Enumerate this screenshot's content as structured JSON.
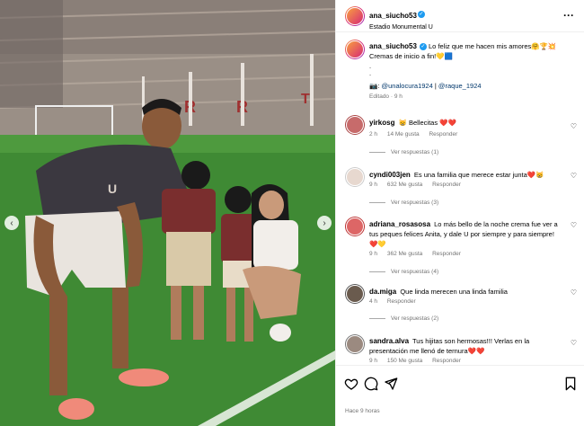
{
  "post": {
    "username": "ana_siucho53",
    "location": "Estadio Monumental U",
    "caption_text": "Lo feliz que me hacen mis amores🤗🏆💥 Cremas de inicio a fin!💛🟦",
    "caption_dots": [
      "."
    ],
    "mentions": [
      "@unalocura1924",
      "@raque_1924"
    ],
    "edited": "Editado · 9 h",
    "time_ago": "Hace 9 horas"
  },
  "comments": [
    {
      "username": "yirkosg",
      "text": "😸 Bellecitas ❤️❤️",
      "time": "2 h",
      "likes": "14 Me gusta",
      "reply": "Responder",
      "view_replies": "Ver respuestas (1)"
    },
    {
      "username": "cyndi003jen",
      "text": "Es una familia que merece estar junta❤️😸",
      "time": "9 h",
      "likes": "632 Me gusta",
      "reply": "Responder",
      "view_replies": "Ver respuestas (3)"
    },
    {
      "username": "adriana_rosasosa",
      "text": "Lo más bello de la noche crema fue ver a tus peques felices Anita, y dale U por siempre y para siempre!❤️💛",
      "time": "9 h",
      "likes": "362 Me gusta",
      "reply": "Responder",
      "view_replies": "Ver respuestas (4)"
    },
    {
      "username": "da.miga",
      "text": "Que linda merecen una linda familia",
      "time": "4 h",
      "likes": "",
      "reply": "Responder",
      "view_replies": "Ver respuestas (2)"
    },
    {
      "username": "sandra.alva",
      "text": "Tus hijitas son hermosas!!! Verlas en la presentación me llenó de ternura❤️❤️",
      "time": "9 h",
      "likes": "150 Me gusta",
      "reply": "Responder",
      "view_replies": ""
    }
  ],
  "icons": {
    "more": "more-horizontal-icon",
    "like": "heart-icon",
    "comment": "comment-icon",
    "share": "send-icon",
    "save": "bookmark-icon",
    "nav_prev": "chevron-left-icon",
    "nav_next": "chevron-right-icon"
  },
  "colors": {
    "link": "#00376b",
    "muted": "#737373",
    "verified": "#1d9bf0"
  }
}
